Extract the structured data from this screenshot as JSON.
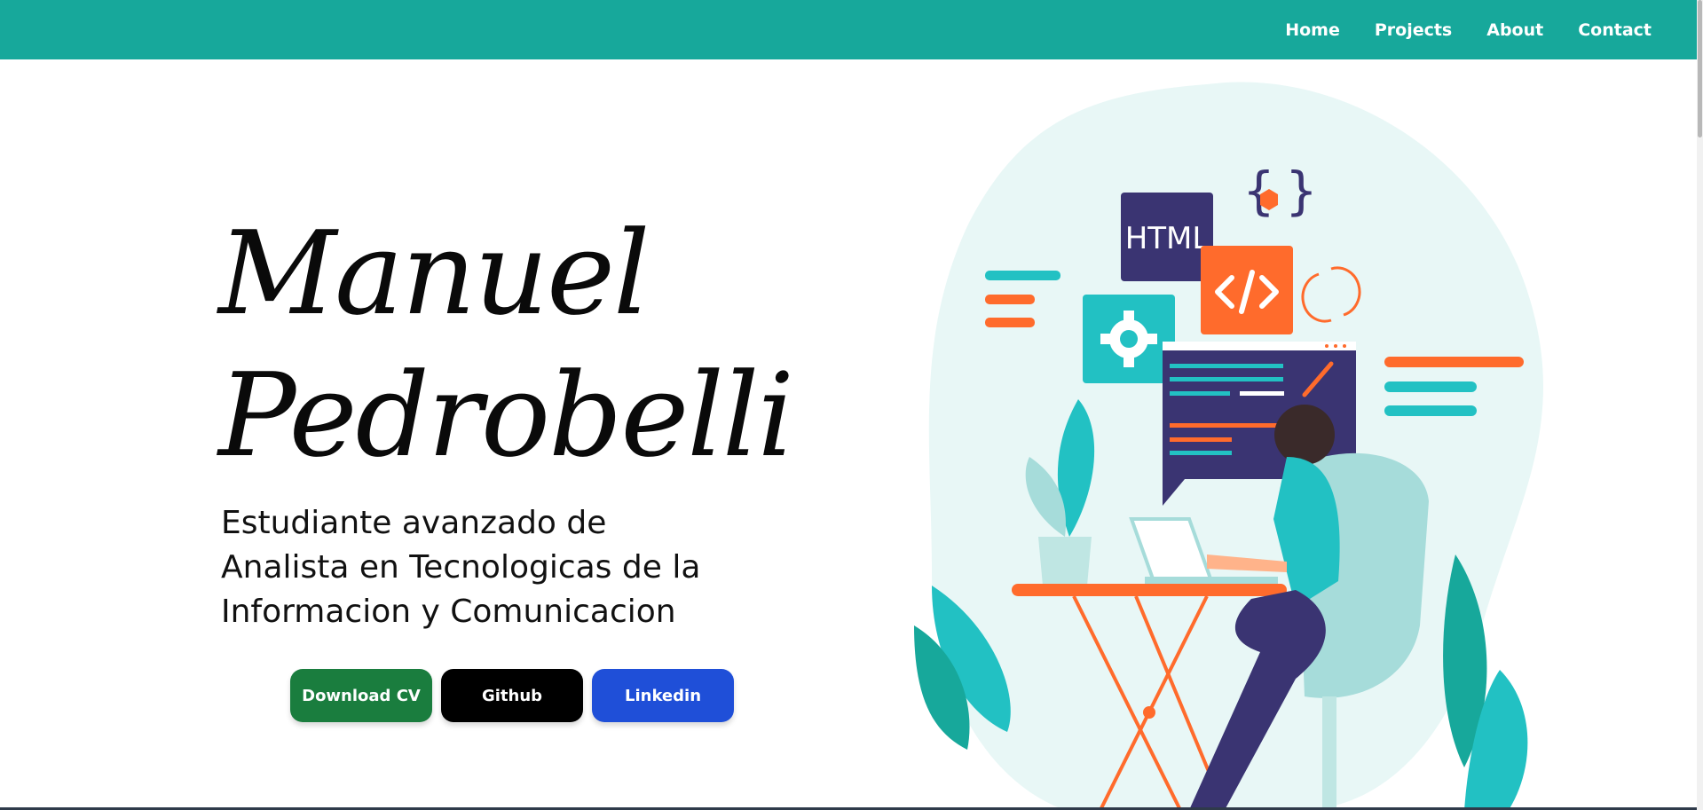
{
  "nav": {
    "items": [
      {
        "label": "Home"
      },
      {
        "label": "Projects"
      },
      {
        "label": "About"
      },
      {
        "label": "Contact"
      }
    ]
  },
  "hero": {
    "name_line1": "Manuel",
    "name_line2": "Pedrobelli",
    "subtitle_line1": "Estudiante avanzado de",
    "subtitle_line2": "Analista en Tecnologicas de la",
    "subtitle_line3": "Informacion y Comunicacion"
  },
  "buttons": {
    "download_cv": "Download CV",
    "github": "Github",
    "linkedin": "Linkedin"
  },
  "illustration": {
    "html_label": "HTML",
    "icons": [
      "braces-icon",
      "code-icon",
      "gear-icon",
      "refresh-icon"
    ]
  },
  "colors": {
    "navbar": "#17a89b",
    "download_cv": "#1a7d3e",
    "github": "#000000",
    "linkedin": "#1f4fd8",
    "accent_orange": "#ff6b2c",
    "accent_teal": "#22c1c3",
    "accent_navy": "#3a3472"
  }
}
